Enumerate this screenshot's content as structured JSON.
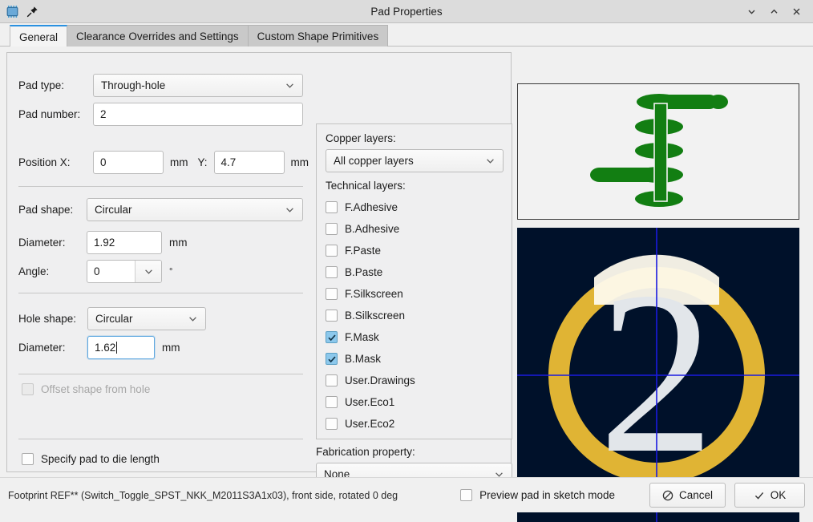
{
  "window": {
    "title": "Pad Properties",
    "app_icon": "chip-icon",
    "pin_icon": "pin-icon",
    "minimize_label": "chevron-down-icon",
    "maximize_label": "chevron-up-icon",
    "close_label": "close-icon"
  },
  "tabs": [
    {
      "label": "General",
      "active": true
    },
    {
      "label": "Clearance Overrides and Settings",
      "active": false
    },
    {
      "label": "Custom Shape Primitives",
      "active": false
    }
  ],
  "general": {
    "pad_type_label": "Pad type:",
    "pad_type_value": "Through-hole",
    "pad_number_label": "Pad number:",
    "pad_number_value": "2",
    "position_x_label": "Position X:",
    "position_x_value": "0",
    "position_x_unit": "mm",
    "position_y_label": "Y:",
    "position_y_value": "4.7",
    "position_y_unit": "mm",
    "pad_shape_label": "Pad shape:",
    "pad_shape_value": "Circular",
    "pad_diameter_label": "Diameter:",
    "pad_diameter_value": "1.92",
    "pad_diameter_unit": "mm",
    "angle_label": "Angle:",
    "angle_value": "0",
    "angle_unit": "°",
    "hole_shape_label": "Hole shape:",
    "hole_shape_value": "Circular",
    "hole_diameter_label": "Diameter:",
    "hole_diameter_value": "1.62",
    "hole_diameter_unit": "mm",
    "offset_shape_label": "Offset shape from hole",
    "offset_shape_checked": false,
    "offset_shape_disabled": true,
    "die_length_label": "Specify pad to die length",
    "die_length_checked": false
  },
  "layers": {
    "copper_label": "Copper layers:",
    "copper_value": "All copper layers",
    "technical_label": "Technical layers:",
    "items": [
      {
        "label": "F.Adhesive",
        "checked": false
      },
      {
        "label": "B.Adhesive",
        "checked": false
      },
      {
        "label": "F.Paste",
        "checked": false
      },
      {
        "label": "B.Paste",
        "checked": false
      },
      {
        "label": "F.Silkscreen",
        "checked": false
      },
      {
        "label": "B.Silkscreen",
        "checked": false
      },
      {
        "label": "F.Mask",
        "checked": true
      },
      {
        "label": "B.Mask",
        "checked": true
      },
      {
        "label": "User.Drawings",
        "checked": false
      },
      {
        "label": "User.Eco1",
        "checked": false
      },
      {
        "label": "User.Eco2",
        "checked": false
      }
    ],
    "fabrication_label": "Fabrication property:",
    "fabrication_value": "None"
  },
  "preview": {
    "stack_name": "pad-stack-cross-section",
    "pad_name": "pad-render-preview",
    "pad_number_text": "2",
    "colors": {
      "stack_copper": "#127e12",
      "stack_background": "#f2f2f2",
      "pad_background": "#00112a",
      "pad_copper": "#e0b434",
      "pad_crosshair": "#1a1ae0",
      "pad_number": "#e2e6ea",
      "pad_mask_highlight": "#fdfaec"
    }
  },
  "footer": {
    "status": "Footprint REF** (Switch_Toggle_SPST_NKK_M2011S3A1x03), front side, rotated 0 deg",
    "sketch_mode_label": "Preview pad in sketch mode",
    "sketch_mode_checked": false,
    "cancel_label": "Cancel",
    "ok_label": "OK"
  }
}
